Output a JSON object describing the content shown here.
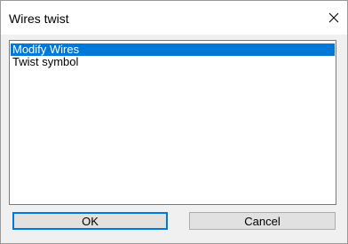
{
  "window": {
    "title": "Wires twist"
  },
  "list": {
    "items": [
      {
        "label": "Modify Wires",
        "selected": true
      },
      {
        "label": "Twist symbol",
        "selected": false
      }
    ]
  },
  "buttons": {
    "ok_label": "OK",
    "cancel_label": "Cancel"
  },
  "colors": {
    "selection": "#0078d7",
    "dialog_bg": "#f0f0f0"
  },
  "icons": {
    "close": "close-icon"
  }
}
